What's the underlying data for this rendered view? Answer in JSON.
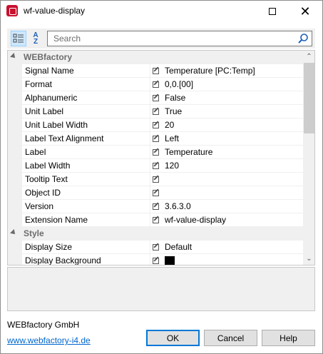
{
  "window": {
    "title": "wf-value-display",
    "maximize_icon": "maximize-icon",
    "close_icon": "close-icon"
  },
  "toolbar": {
    "categorized_icon": "categorized-view-icon",
    "alphabetical_label_top": "A",
    "alphabetical_label_bottom": "Z",
    "search_placeholder": "Search",
    "search_icon": "search-icon"
  },
  "grid": {
    "categories": [
      {
        "label": "WEBfactory",
        "properties": [
          {
            "name": "Signal Name",
            "value": "Temperature [PC:Temp]"
          },
          {
            "name": "Format",
            "value": "0,0.[00]"
          },
          {
            "name": "Alphanumeric",
            "value": "False"
          },
          {
            "name": "Unit Label",
            "value": "True"
          },
          {
            "name": "Unit Label Width",
            "value": "20"
          },
          {
            "name": "Label Text Alignment",
            "value": "Left"
          },
          {
            "name": "Label",
            "value": "Temperature"
          },
          {
            "name": "Label Width",
            "value": "120"
          },
          {
            "name": "Tooltip Text",
            "value": ""
          },
          {
            "name": "Object ID",
            "value": ""
          },
          {
            "name": "Version",
            "value": "3.6.3.0"
          },
          {
            "name": "Extension Name",
            "value": "wf-value-display"
          }
        ]
      },
      {
        "label": "Style",
        "properties": [
          {
            "name": "Display Size",
            "value": "Default"
          },
          {
            "name": "Display Background",
            "value": "",
            "swatch_color": "#000000"
          }
        ]
      }
    ]
  },
  "footer": {
    "company": "WEBfactory GmbH",
    "link": "www.webfactory-i4.de",
    "ok_label": "OK",
    "cancel_label": "Cancel",
    "help_label": "Help"
  },
  "colors": {
    "accent": "#0078d7",
    "link": "#0066cc",
    "app_icon": "#c8102e"
  }
}
